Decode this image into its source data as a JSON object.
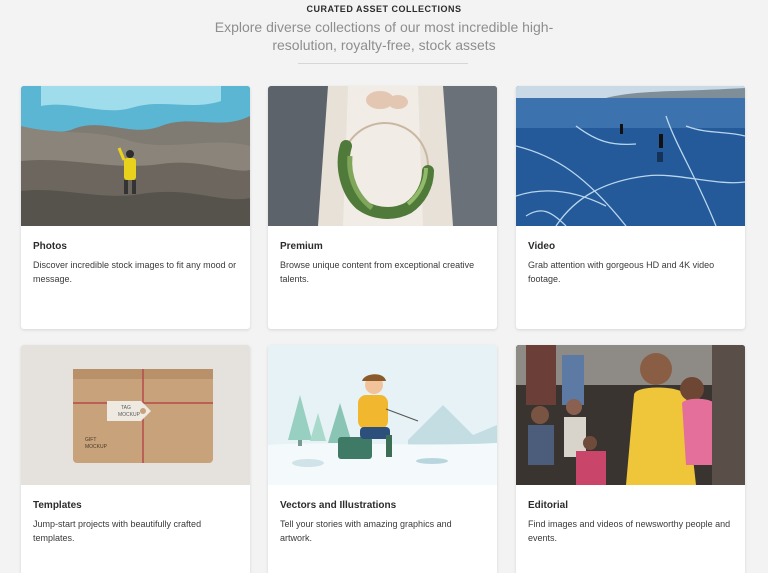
{
  "header": {
    "eyebrow": "CURATED ASSET COLLECTIONS",
    "subtitle": "Explore diverse collections of our most incredible high-resolution, royalty-free, stock assets"
  },
  "cards": [
    {
      "title": "Photos",
      "description": "Discover incredible stock images to fit any mood or message.",
      "image": "glacier-hiker-photo"
    },
    {
      "title": "Premium",
      "description": "Browse unique content from exceptional creative talents.",
      "image": "person-holding-wreath-photo"
    },
    {
      "title": "Video",
      "description": "Grab attention with gorgeous HD and 4K video footage.",
      "image": "frozen-lake-skaters-photo"
    },
    {
      "title": "Templates",
      "description": "Jump-start projects with beautifully crafted templates.",
      "image": "gift-package-mockup",
      "mockup_tag": "TAG\nMOCKUP",
      "mockup_gift": "GIFT\nMOCKUP"
    },
    {
      "title": "Vectors and Illustrations",
      "description": "Tell your stories with amazing graphics and artwork.",
      "image": "ice-fishing-illustration"
    },
    {
      "title": "Editorial",
      "description": "Find images and videos of newsworthy people and events.",
      "image": "crowd-mother-child-photo"
    }
  ]
}
